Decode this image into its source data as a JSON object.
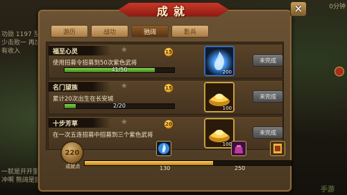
{
  "background": {
    "left_top": "功勋 1197 至少击败一 再加有收入",
    "left_bottom": "一就是开开里 啦冲啊 熊阔是面",
    "right_top": "0分钟"
  },
  "title": "成就",
  "tabs": [
    {
      "label": "游历",
      "active": false
    },
    {
      "label": "战功",
      "active": false
    },
    {
      "label": "驰阔",
      "active": true
    },
    {
      "label": "影兵",
      "active": false
    }
  ],
  "achievements": [
    {
      "name": "福至心灵",
      "points": "15",
      "description": "使用招募令招募到50次紫色武将",
      "progress_text": "41/50",
      "progress_fraction": 0.82,
      "reward_icon": "blue-flame-icon",
      "reward_count": "200",
      "status": "未完成"
    },
    {
      "name": "名门望族",
      "points": "15",
      "description": "累计20次出生在长安城",
      "progress_text": "2/20",
      "progress_fraction": 0.1,
      "reward_icon": "gold-ingot-icon",
      "reward_count": "100",
      "status": "未完成"
    },
    {
      "name": "十步芳草",
      "points": "20",
      "description": "在一次五连招募中招募到三个紫色武将",
      "progress_text": "",
      "progress_fraction": 0,
      "reward_icon": "gold-ingot-icon",
      "reward_count": "100",
      "status": "未完成"
    }
  ],
  "score": {
    "value": "220",
    "label": "成就点",
    "fill_fraction": 0.62,
    "milestones": [
      {
        "value": "130",
        "icon": "blue-token-icon"
      },
      {
        "value": "250",
        "icon": "purple-bag-icon"
      },
      {
        "value": "",
        "icon": "golden-scroll-icon"
      }
    ]
  }
}
